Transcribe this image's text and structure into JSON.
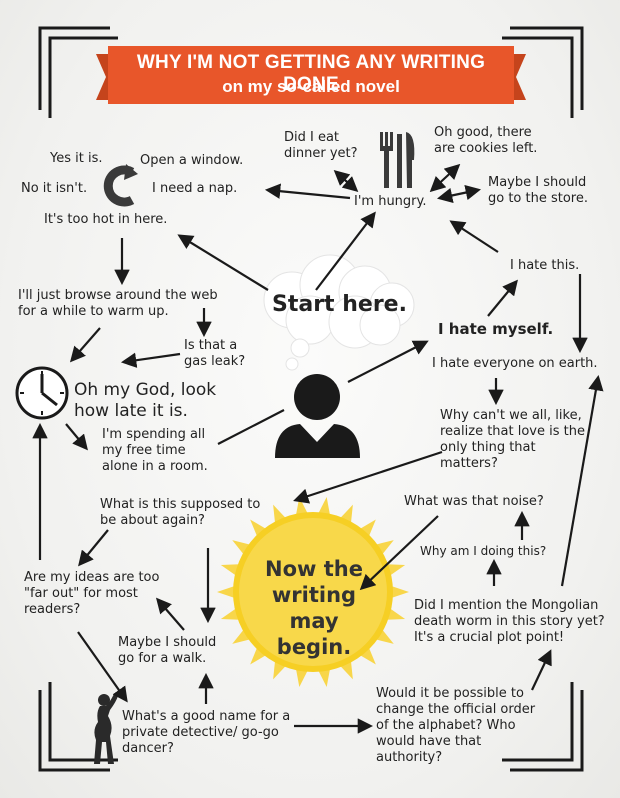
{
  "banner": {
    "title": "WHY I'M NOT GETTING ANY WRITING DONE",
    "subtitle": "on my so-called novel",
    "color": "#e8562a"
  },
  "start": {
    "label": "Start here."
  },
  "center_goal": {
    "label": "Now the writing may begin.",
    "color": "#f6cf24"
  },
  "nodes": {
    "yes_it_is": "Yes it is.",
    "open_window": "Open a window.",
    "no_it_isnt": "No it isn't.",
    "need_nap": "I need a nap.",
    "too_hot": "It's too hot in here.",
    "did_i_eat": "Did I eat dinner yet?",
    "im_hungry": "I'm hungry.",
    "cookies_left": "Oh good, there are cookies left.",
    "go_to_store": "Maybe I should go to the store.",
    "i_hate_this": "I hate this.",
    "browse_web": "I'll just browse around the web for a while to warm up.",
    "gas_leak": "Is that a gas leak?",
    "i_hate_myself": "I hate myself.",
    "hate_everyone": "I hate everyone on earth.",
    "how_late": "Oh my God, look how late it is.",
    "free_time_alone": "I'm spending all my free time alone in a room.",
    "love_matters": "Why can't we all, like, realize that love is the only thing that matters?",
    "what_about": "What is this supposed to be about again?",
    "what_noise": "What was that noise?",
    "why_doing": "Why am I doing this?",
    "far_out": "Are my ideas are too \"far out\" for most readers?",
    "mongolian_worm": "Did I mention the Mongolian death worm in this story yet? It's a crucial plot point!",
    "go_for_walk": "Maybe I should go for a walk.",
    "detective_name": "What's a good name for a private detective/ go-go dancer?",
    "change_alphabet": "Would it be possible to change the official order of the alphabet? Who would have that authority?"
  },
  "icons": [
    "refresh-icon",
    "cutlery-icon",
    "clock-icon",
    "person-icon",
    "thought-cloud-icon",
    "sun-icon",
    "dancer-silhouette-icon"
  ],
  "colors": {
    "background": "#f3f3f1",
    "ink": "#222222",
    "banner": "#e8562a",
    "sun": "#f6cf24",
    "sun_ray": "#f8d64a"
  }
}
